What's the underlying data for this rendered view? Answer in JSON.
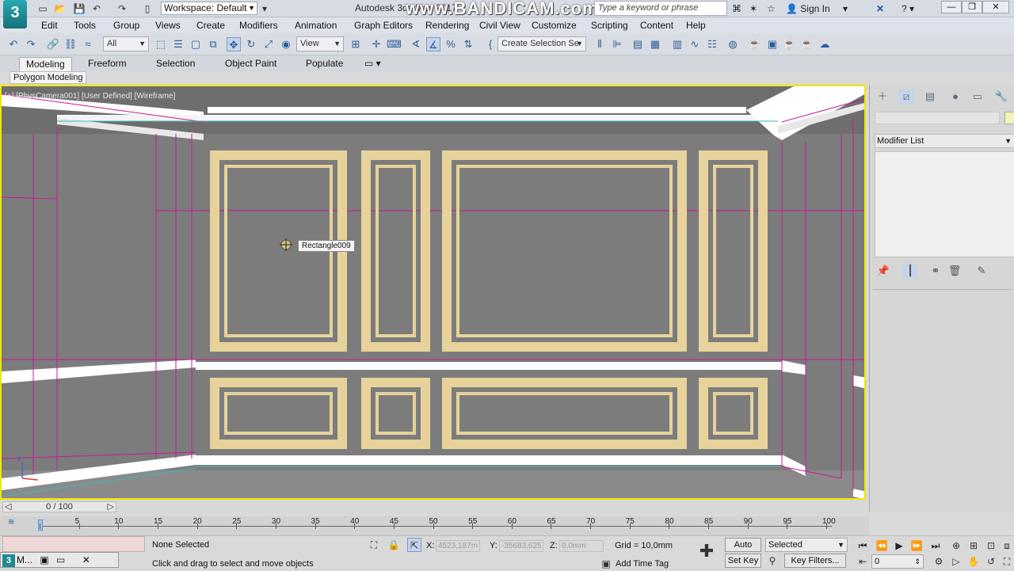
{
  "title_bar": {
    "app_logo": "3",
    "workspace_label": "Workspace: Default",
    "app_title": "Autodesk 3ds Max 2017",
    "watermark": "www.BANDICAM.com",
    "search_placeholder": "Type a keyword or phrase",
    "sign_in_label": "Sign In",
    "help_label": "?"
  },
  "menu_bar": {
    "items": [
      "Edit",
      "Tools",
      "Group",
      "Views",
      "Create",
      "Modifiers",
      "Animation",
      "Graph Editors",
      "Rendering",
      "Civil View",
      "Customize",
      "Scripting",
      "Content",
      "Help"
    ]
  },
  "main_toolbar": {
    "selection_filter": "All",
    "reference_coord": "View",
    "named_selection": "Create Selection Se"
  },
  "ribbon": {
    "tabs": [
      "Modeling",
      "Freeform",
      "Selection",
      "Object Paint",
      "Populate"
    ],
    "active_tab": "Modeling",
    "panel_label": "Polygon Modeling"
  },
  "viewport": {
    "label": "[+] [PhysCamera001] [User Defined] [Wireframe]",
    "tooltip": "Rectangle009",
    "axis_label": "z"
  },
  "command_panel": {
    "modifier_list_label": "Modifier List",
    "object_color": "#f2f5b5"
  },
  "time_slider": {
    "frame_text": "0 / 100",
    "ticks": [
      "0",
      "5",
      "10",
      "15",
      "20",
      "25",
      "30",
      "35",
      "40",
      "45",
      "50",
      "55",
      "60",
      "65",
      "70",
      "75",
      "80",
      "85",
      "90",
      "95",
      "100"
    ]
  },
  "status_bar": {
    "selection_status": "None Selected",
    "prompt": "Click and drag to select and move objects",
    "x_label": "X:",
    "x_value": "4523,187m",
    "y_label": "Y:",
    "y_value": "-35683,625",
    "z_label": "Z:",
    "z_value": "0,0mm",
    "grid": "Grid = 10,0mm",
    "add_time_tag": "Add Time Tag",
    "auto_key": "Auto Key",
    "set_key": "Set Key",
    "key_mode": "Selected",
    "key_filters": "Key Filters...",
    "current_frame": "0",
    "taskbar_label": "M..."
  },
  "colors": {
    "viewport_bg": "#7b7b7b",
    "viewport_border": "#f2e600",
    "panel_molding": "#e6d29a",
    "wireframe": "#c8189a",
    "trim": "#ffffff"
  }
}
